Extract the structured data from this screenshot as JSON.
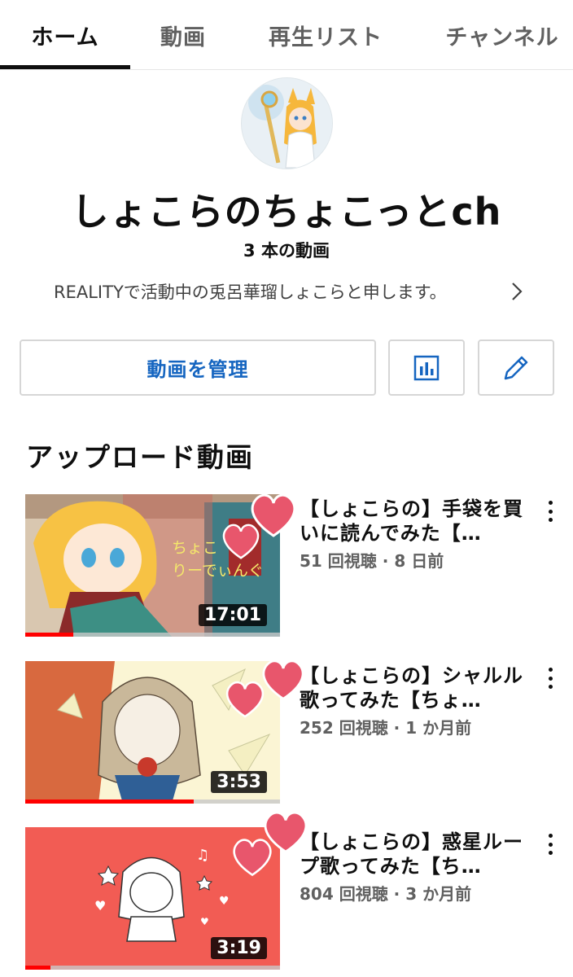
{
  "tabs": [
    {
      "label": "ホーム",
      "active": true
    },
    {
      "label": "動画",
      "active": false
    },
    {
      "label": "再生リスト",
      "active": false
    },
    {
      "label": "チャンネル",
      "active": false
    }
  ],
  "channel": {
    "title": "しょこらのちょこっとch",
    "video_count": "3 本の動画",
    "description": "REALITYで活動中の兎呂華瑠しょこらと申します。"
  },
  "actions": {
    "manage_label": "動画を管理",
    "analytics_icon": "bar-chart-icon",
    "edit_icon": "pencil-icon"
  },
  "uploads": {
    "section_title": "アップロード動画",
    "videos": [
      {
        "title": "【しょこらの】手袋を買いに読んでみた【…",
        "meta": "51 回視聴 · 8 日前",
        "duration": "17:01",
        "progress": 0.19,
        "thumb_text": "ちょこ\nりーでぃんぐ"
      },
      {
        "title": "【しょこらの】シャルル歌ってみた【ちょ…",
        "meta": "252 回視聴 · 1 か月前",
        "duration": "3:53",
        "progress": 0.66
      },
      {
        "title": "【しょこらの】惑星ループ歌ってみた【ち…",
        "meta": "804 回視聴 · 3 か月前",
        "duration": "3:19",
        "progress": 0.1
      }
    ]
  },
  "colors": {
    "accent_blue": "#1565c0",
    "progress_red": "#ff0000",
    "heart_pink": "#e8566c"
  }
}
